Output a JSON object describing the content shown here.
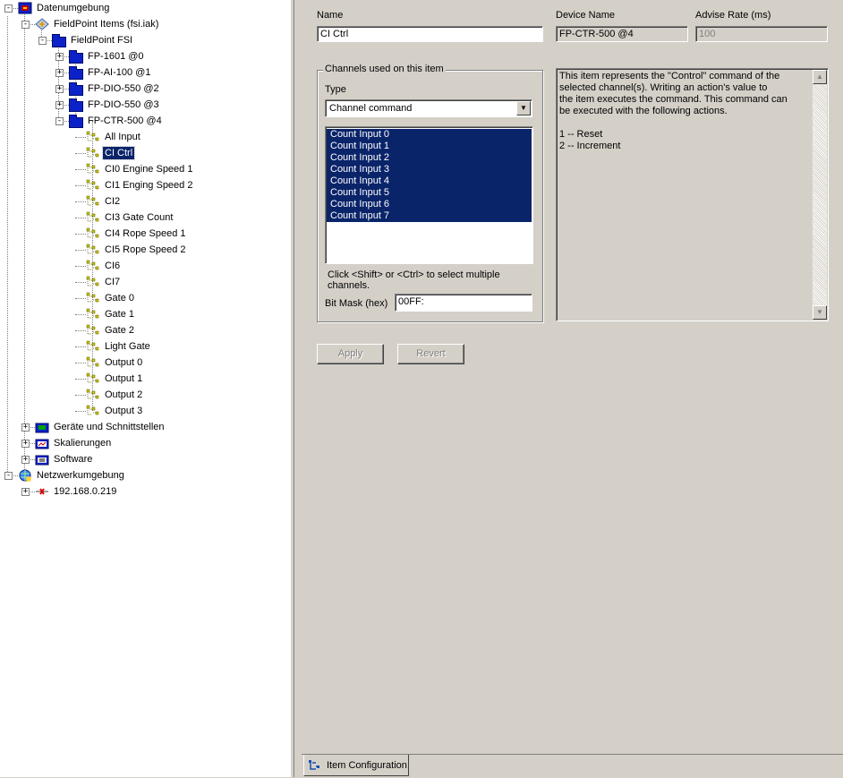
{
  "tree": {
    "nodes": [
      {
        "id": "datenumgebung",
        "label": "Datenumgebung",
        "depth": 1,
        "expander": "-",
        "icon": "data-environment-icon"
      },
      {
        "id": "fieldpoint-items",
        "label": "FieldPoint Items (fsi.iak)",
        "depth": 2,
        "expander": "-",
        "icon": "fieldpoint-icon"
      },
      {
        "id": "fieldpoint-fsi",
        "label": "FieldPoint FSI",
        "depth": 3,
        "expander": "-",
        "icon": "folder-icon"
      },
      {
        "id": "fp-1601",
        "label": "FP-1601 @0",
        "depth": 4,
        "expander": "+",
        "icon": "folder-icon"
      },
      {
        "id": "fp-ai-100",
        "label": "FP-AI-100 @1",
        "depth": 4,
        "expander": "+",
        "icon": "folder-icon"
      },
      {
        "id": "fp-dio-550-2",
        "label": "FP-DIO-550 @2",
        "depth": 4,
        "expander": "+",
        "icon": "folder-icon"
      },
      {
        "id": "fp-dio-550-3",
        "label": "FP-DIO-550 @3",
        "depth": 4,
        "expander": "+",
        "icon": "folder-icon"
      },
      {
        "id": "fp-ctr-500",
        "label": "FP-CTR-500 @4",
        "depth": 4,
        "expander": "-",
        "icon": "folder-icon"
      },
      {
        "id": "all-input",
        "label": "All Input",
        "depth": 5,
        "icon": "channel-icon"
      },
      {
        "id": "ci-ctrl",
        "label": "CI Ctrl",
        "depth": 5,
        "icon": "channel-icon",
        "selected": true
      },
      {
        "id": "ci0",
        "label": "CI0 Engine Speed 1",
        "depth": 5,
        "icon": "channel-icon"
      },
      {
        "id": "ci1",
        "label": "CI1 Enging Speed 2",
        "depth": 5,
        "icon": "channel-icon"
      },
      {
        "id": "ci2",
        "label": "CI2",
        "depth": 5,
        "icon": "channel-icon"
      },
      {
        "id": "ci3",
        "label": "CI3 Gate Count",
        "depth": 5,
        "icon": "channel-icon"
      },
      {
        "id": "ci4",
        "label": "CI4 Rope Speed 1",
        "depth": 5,
        "icon": "channel-icon"
      },
      {
        "id": "ci5",
        "label": "CI5 Rope Speed 2",
        "depth": 5,
        "icon": "channel-icon"
      },
      {
        "id": "ci6",
        "label": "CI6",
        "depth": 5,
        "icon": "channel-icon"
      },
      {
        "id": "ci7",
        "label": "CI7",
        "depth": 5,
        "icon": "channel-icon"
      },
      {
        "id": "gate0",
        "label": "Gate 0",
        "depth": 5,
        "icon": "channel-icon"
      },
      {
        "id": "gate1",
        "label": "Gate 1",
        "depth": 5,
        "icon": "channel-icon"
      },
      {
        "id": "gate2",
        "label": "Gate 2",
        "depth": 5,
        "icon": "channel-icon"
      },
      {
        "id": "light-gate",
        "label": "Light Gate",
        "depth": 5,
        "icon": "channel-icon"
      },
      {
        "id": "output0",
        "label": "Output 0",
        "depth": 5,
        "icon": "channel-icon"
      },
      {
        "id": "output1",
        "label": "Output 1",
        "depth": 5,
        "icon": "channel-icon"
      },
      {
        "id": "output2",
        "label": "Output 2",
        "depth": 5,
        "icon": "channel-icon"
      },
      {
        "id": "output3",
        "label": "Output 3",
        "depth": 5,
        "icon": "channel-icon"
      },
      {
        "id": "geraete",
        "label": "Geräte und Schnittstellen",
        "depth": 2,
        "expander": "+",
        "icon": "devices-icon"
      },
      {
        "id": "skalierungen",
        "label": "Skalierungen",
        "depth": 2,
        "expander": "+",
        "icon": "scaling-icon"
      },
      {
        "id": "software",
        "label": "Software",
        "depth": 2,
        "expander": "+",
        "icon": "software-icon"
      },
      {
        "id": "netzwerk",
        "label": "Netzwerkumgebung",
        "depth": 1,
        "expander": "-",
        "icon": "network-icon"
      },
      {
        "id": "ip",
        "label": "192.168.0.219",
        "depth": 2,
        "expander": "+",
        "icon": "host-icon"
      }
    ]
  },
  "form": {
    "name_label": "Name",
    "name_value": "CI Ctrl",
    "device_label": "Device Name",
    "device_value": "FP-CTR-500 @4",
    "advise_label": "Advise Rate (ms)",
    "advise_value": "100",
    "group_title": "Channels used on this item",
    "type_label": "Type",
    "type_value": "Channel command",
    "channels": [
      "Count Input 0",
      "Count Input 1",
      "Count Input 2",
      "Count Input 3",
      "Count Input 4",
      "Count Input 5",
      "Count Input 6",
      "Count Input 7"
    ],
    "hint": "Click <Shift> or <Ctrl> to select multiple channels.",
    "bitmask_label": "Bit Mask (hex)",
    "bitmask_value": "00FF:",
    "description": "This item represents the \"Control\" command of the\nselected channel(s).  Writing an action's value to\nthe item executes the command.  This command can\nbe executed with the following actions.\n\n1 -- Reset\n2 -- Increment",
    "apply_label": "Apply",
    "revert_label": "Revert"
  },
  "tabs": [
    {
      "label": "Item Configuration",
      "icon": "item-config-icon"
    }
  ],
  "colors": {
    "selection": "#0a246a",
    "window": "#d4d0c8",
    "folder": "#0a22c8"
  }
}
